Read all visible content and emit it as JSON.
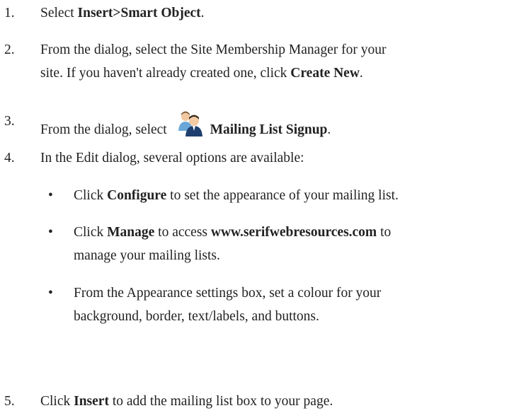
{
  "steps": [
    {
      "num": "1.",
      "pre": "Select ",
      "bold1": "Insert>Smart Object",
      "post": "."
    },
    {
      "num": "2.",
      "line1": "From the dialog, select the Site Membership Manager for your",
      "line2_pre": "site.  If you haven't already created one, click ",
      "bold1": "Create New",
      "post": "."
    },
    {
      "num": "3.",
      "pre": "From the dialog, select ",
      "icon": "users-icon",
      "bold1": "Mailing List Signup",
      "post": "."
    },
    {
      "num": "4.",
      "text": "In the Edit dialog, several options are available:"
    },
    {
      "num": "5.",
      "pre": "Click ",
      "bold1": "Insert",
      "post": " to add the mailing list box to your page."
    }
  ],
  "bullets": [
    {
      "mark": "•",
      "pre": "Click ",
      "bold1": "Configure",
      "post": " to set the appearance of your mailing list."
    },
    {
      "mark": "•",
      "pre": "Click ",
      "bold1": "Manage",
      "mid": " to access ",
      "bold2": "www.serifwebresources.com",
      "post": " to",
      "line2": "manage your mailing lists."
    },
    {
      "mark": "•",
      "line1": "From the Appearance settings box, set a colour for your",
      "line2": "background, border, text/labels, and buttons."
    }
  ]
}
